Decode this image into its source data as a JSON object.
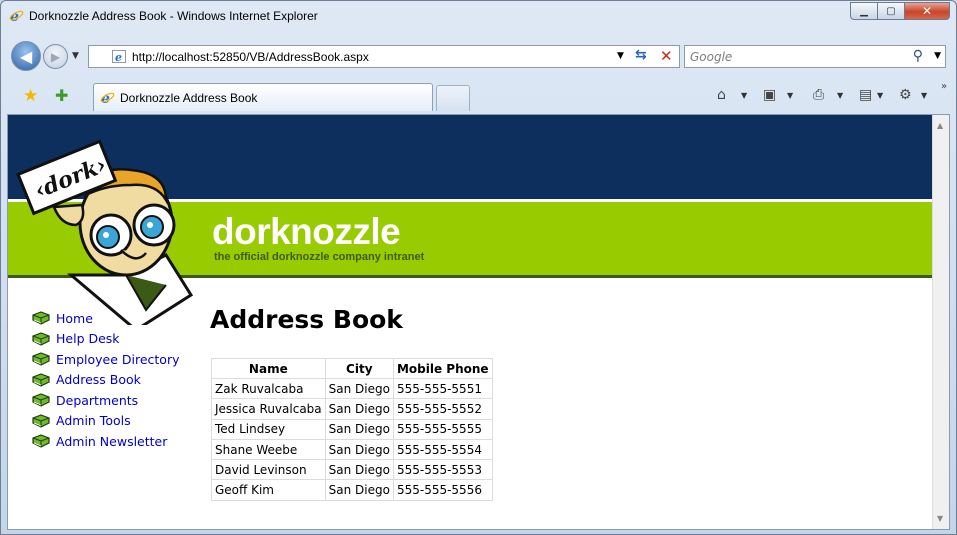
{
  "window": {
    "title": "Dorknozzle Address Book - Windows Internet Explorer"
  },
  "address_bar": {
    "url": "http://localhost:52850/VB/AddressBook.aspx"
  },
  "search": {
    "placeholder": "Google"
  },
  "tab": {
    "label": "Dorknozzle Address Book"
  },
  "site": {
    "brand": "dorknozzle",
    "tagline": "the official dorknozzle company intranet",
    "sign_text": "‹dork›"
  },
  "menu": {
    "items": [
      {
        "label": "Home"
      },
      {
        "label": "Help Desk"
      },
      {
        "label": "Employee Directory"
      },
      {
        "label": "Address Book"
      },
      {
        "label": "Departments"
      },
      {
        "label": "Admin Tools"
      },
      {
        "label": "Admin Newsletter"
      }
    ]
  },
  "main": {
    "heading": "Address Book",
    "table": {
      "columns": [
        "Name",
        "City",
        "Mobile Phone"
      ],
      "rows": [
        [
          "Zak Ruvalcaba",
          "San Diego",
          "555-555-5551"
        ],
        [
          "Jessica Ruvalcaba",
          "San Diego",
          "555-555-5552"
        ],
        [
          "Ted Lindsey",
          "San Diego",
          "555-555-5555"
        ],
        [
          "Shane Weebe",
          "San Diego",
          "555-555-5554"
        ],
        [
          "David Levinson",
          "San Diego",
          "555-555-5553"
        ],
        [
          "Geoff Kim",
          "San Diego",
          "555-555-5556"
        ]
      ]
    }
  },
  "icons": {
    "menu_bullet": "green-book-icon",
    "colors": {
      "header_navy": "#0d2f5e",
      "header_green": "#99cc00",
      "link": "#0000cc"
    }
  }
}
